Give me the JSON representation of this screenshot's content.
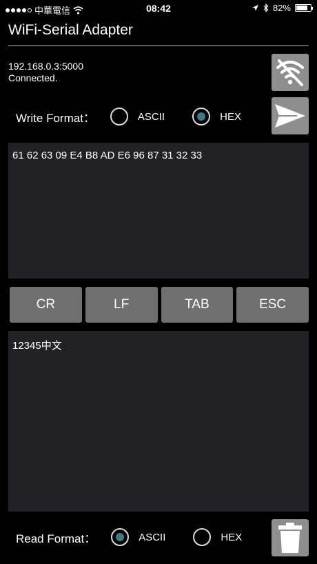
{
  "status_bar": {
    "carrier": "中華電信",
    "time": "08:42",
    "battery": "82%",
    "battery_level": 0.82
  },
  "app": {
    "title": "WiFi-Serial Adapter"
  },
  "connection": {
    "address": "192.168.0.3:5000",
    "status": "Connected."
  },
  "write_format": {
    "label": "Write Format：",
    "options": [
      {
        "label": "ASCII",
        "checked": false
      },
      {
        "label": "HEX",
        "checked": true
      }
    ]
  },
  "write_text": "61 62 63 09 E4 B8 AD E6 96 87 31 32 33",
  "control_keys": [
    {
      "label": "CR"
    },
    {
      "label": "LF"
    },
    {
      "label": "TAB"
    },
    {
      "label": "ESC"
    }
  ],
  "read_text": "12345中文",
  "read_format": {
    "label": "Read Format：",
    "options": [
      {
        "label": "ASCII",
        "checked": true
      },
      {
        "label": "HEX",
        "checked": false
      }
    ]
  },
  "icons": {
    "disconnect": "wifi-off-icon",
    "send": "send-icon",
    "clear": "trash-icon"
  }
}
